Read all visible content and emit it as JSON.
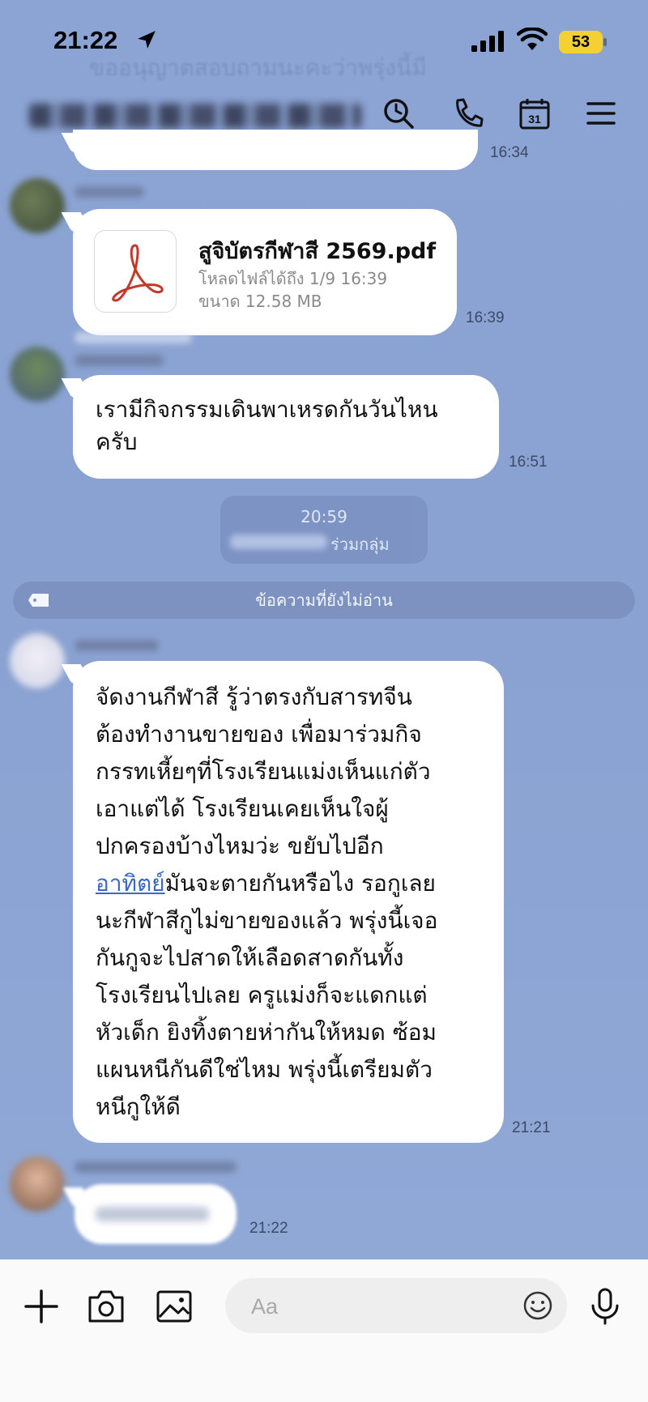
{
  "status_bar": {
    "time": "21:22",
    "battery": "53"
  },
  "header": {
    "ghost_text": "ขออนุญาตสอบถามนะคะว่าพรุ่งนี้มี"
  },
  "messages": {
    "prev_time": "16:34",
    "file": {
      "name": "สูจิบัตรกีฬาสี 2569.pdf",
      "expiry": "โหลดไฟล์ได้ถึง 1/9 16:39",
      "size": "ขนาด 12.58 MB",
      "time": "16:39"
    },
    "parade": {
      "lines": [
        "เรามีกิจกรรมเดินพาเหรดกันวันไหน",
        "ครับ"
      ],
      "time": "16:51"
    },
    "system": {
      "time": "20:59",
      "join_text": "ร่วมกลุ่ม"
    },
    "unread_label": "ข้อความที่ยังไม่อ่าน",
    "long": {
      "lines": [
        "จัดงานกีฬาสี รู้ว่าตรงกับสารทจีน",
        "ต้องทำงานขายของ เพื่อมาร่วมกิจ",
        "กรรทเหี้ยๆที่โรงเรียนแม่งเห็นแก่ตัว",
        "เอาแต่ได้ โรงเรียนเคยเห็นใจผู้",
        "ปกครองบ้างไหมว่ะ ขยับไปอีก"
      ],
      "link_word": "อาทิตย์",
      "line6_rest": "มันจะตายกันหรือไง รอกูเลย",
      "lines_after": [
        "นะกีฬาสีกูไม่ขายของแล้ว พรุ่งนี้เจอ",
        "กันกูจะไปสาดให้เลือดสาดกันทั้ง",
        "โรงเรียนไปเลย ครูแม่งก็จะแดกแต่",
        "หัวเด็ก ยิงทิ้งตายห่ากันให้หมด ซ้อม",
        "แผนหนีกันดีใช่ไหม พรุ่งนี้เตรียมตัว",
        "หนีกูให้ดี"
      ],
      "time": "21:21"
    },
    "last_time": "21:22"
  },
  "input_bar": {
    "placeholder": "Aa"
  },
  "icons": {
    "location": "location-arrow-icon",
    "signal": "signal-icon",
    "wifi": "wifi-icon",
    "search": "search-icon",
    "call": "phone-icon",
    "calendar": "calendar-icon",
    "menu": "menu-icon",
    "pdf": "pdf-icon",
    "plus": "plus-icon",
    "camera": "camera-icon",
    "image": "image-icon",
    "emoji": "emoji-icon",
    "mic": "microphone-icon"
  },
  "calendar_day": "31",
  "colors": {
    "chat_bg": "#8aa3d2",
    "bubble": "#ffffff",
    "link": "#3c66c8",
    "battery": "#f4d033"
  }
}
